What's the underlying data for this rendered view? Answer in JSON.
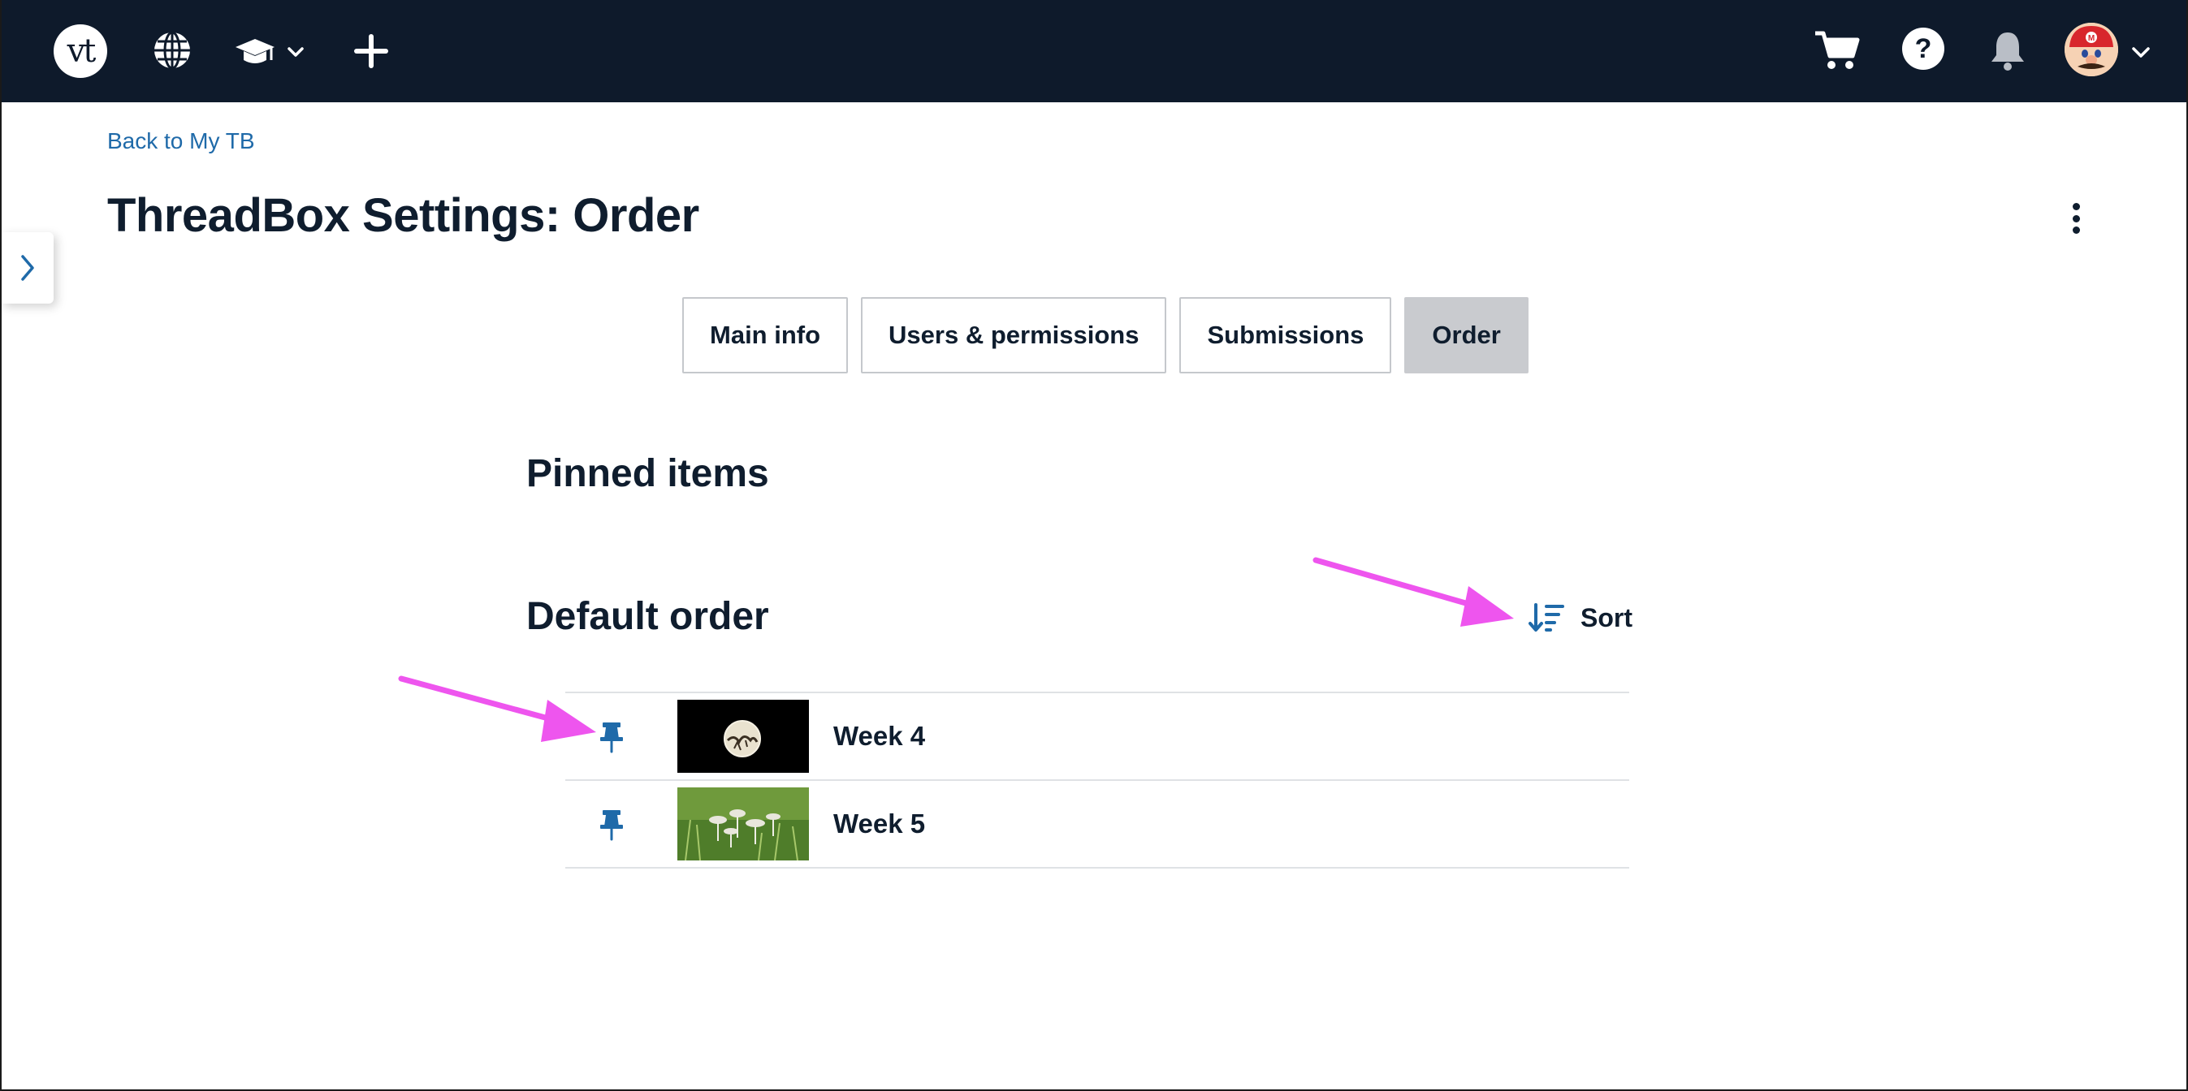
{
  "nav": {
    "logo_text": "vt",
    "icons": [
      "globe-icon",
      "graduation-cap-icon",
      "chevron-down-icon",
      "plus-icon",
      "cart-icon",
      "help-icon",
      "bell-icon",
      "avatar",
      "chevron-down-icon"
    ],
    "help_glyph": "?"
  },
  "back_link": "Back to My TB",
  "page_title": "ThreadBox Settings: Order",
  "tabs": [
    {
      "label": "Main info",
      "active": false
    },
    {
      "label": "Users & permissions",
      "active": false
    },
    {
      "label": "Submissions",
      "active": false
    },
    {
      "label": "Order",
      "active": true
    }
  ],
  "sections": {
    "pinned_heading": "Pinned items",
    "default_heading": "Default order"
  },
  "sort_label": "Sort",
  "items": [
    {
      "title": "Week 4",
      "thumbnail": "moon-silhouette",
      "pinned_icon": "pin-icon"
    },
    {
      "title": "Week 5",
      "thumbnail": "mushrooms-in-grass",
      "pinned_icon": "pin-icon"
    }
  ],
  "colors": {
    "navbar": "#0e1a2b",
    "link": "#1f6aa9",
    "annotation_arrow": "#ee55ee",
    "active_tab": "#c9cbcf"
  }
}
